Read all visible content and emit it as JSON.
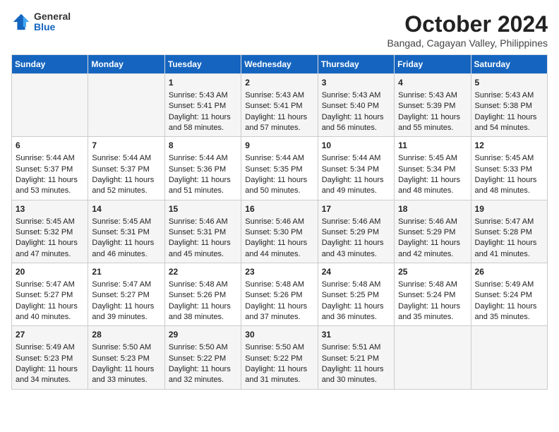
{
  "header": {
    "logo_line1": "General",
    "logo_line2": "Blue",
    "month_title": "October 2024",
    "location": "Bangad, Cagayan Valley, Philippines"
  },
  "days_of_week": [
    "Sunday",
    "Monday",
    "Tuesday",
    "Wednesday",
    "Thursday",
    "Friday",
    "Saturday"
  ],
  "weeks": [
    [
      {
        "day": "",
        "content": ""
      },
      {
        "day": "",
        "content": ""
      },
      {
        "day": "1",
        "content": "Sunrise: 5:43 AM\nSunset: 5:41 PM\nDaylight: 11 hours and 58 minutes."
      },
      {
        "day": "2",
        "content": "Sunrise: 5:43 AM\nSunset: 5:41 PM\nDaylight: 11 hours and 57 minutes."
      },
      {
        "day": "3",
        "content": "Sunrise: 5:43 AM\nSunset: 5:40 PM\nDaylight: 11 hours and 56 minutes."
      },
      {
        "day": "4",
        "content": "Sunrise: 5:43 AM\nSunset: 5:39 PM\nDaylight: 11 hours and 55 minutes."
      },
      {
        "day": "5",
        "content": "Sunrise: 5:43 AM\nSunset: 5:38 PM\nDaylight: 11 hours and 54 minutes."
      }
    ],
    [
      {
        "day": "6",
        "content": "Sunrise: 5:44 AM\nSunset: 5:37 PM\nDaylight: 11 hours and 53 minutes."
      },
      {
        "day": "7",
        "content": "Sunrise: 5:44 AM\nSunset: 5:37 PM\nDaylight: 11 hours and 52 minutes."
      },
      {
        "day": "8",
        "content": "Sunrise: 5:44 AM\nSunset: 5:36 PM\nDaylight: 11 hours and 51 minutes."
      },
      {
        "day": "9",
        "content": "Sunrise: 5:44 AM\nSunset: 5:35 PM\nDaylight: 11 hours and 50 minutes."
      },
      {
        "day": "10",
        "content": "Sunrise: 5:44 AM\nSunset: 5:34 PM\nDaylight: 11 hours and 49 minutes."
      },
      {
        "day": "11",
        "content": "Sunrise: 5:45 AM\nSunset: 5:34 PM\nDaylight: 11 hours and 48 minutes."
      },
      {
        "day": "12",
        "content": "Sunrise: 5:45 AM\nSunset: 5:33 PM\nDaylight: 11 hours and 48 minutes."
      }
    ],
    [
      {
        "day": "13",
        "content": "Sunrise: 5:45 AM\nSunset: 5:32 PM\nDaylight: 11 hours and 47 minutes."
      },
      {
        "day": "14",
        "content": "Sunrise: 5:45 AM\nSunset: 5:31 PM\nDaylight: 11 hours and 46 minutes."
      },
      {
        "day": "15",
        "content": "Sunrise: 5:46 AM\nSunset: 5:31 PM\nDaylight: 11 hours and 45 minutes."
      },
      {
        "day": "16",
        "content": "Sunrise: 5:46 AM\nSunset: 5:30 PM\nDaylight: 11 hours and 44 minutes."
      },
      {
        "day": "17",
        "content": "Sunrise: 5:46 AM\nSunset: 5:29 PM\nDaylight: 11 hours and 43 minutes."
      },
      {
        "day": "18",
        "content": "Sunrise: 5:46 AM\nSunset: 5:29 PM\nDaylight: 11 hours and 42 minutes."
      },
      {
        "day": "19",
        "content": "Sunrise: 5:47 AM\nSunset: 5:28 PM\nDaylight: 11 hours and 41 minutes."
      }
    ],
    [
      {
        "day": "20",
        "content": "Sunrise: 5:47 AM\nSunset: 5:27 PM\nDaylight: 11 hours and 40 minutes."
      },
      {
        "day": "21",
        "content": "Sunrise: 5:47 AM\nSunset: 5:27 PM\nDaylight: 11 hours and 39 minutes."
      },
      {
        "day": "22",
        "content": "Sunrise: 5:48 AM\nSunset: 5:26 PM\nDaylight: 11 hours and 38 minutes."
      },
      {
        "day": "23",
        "content": "Sunrise: 5:48 AM\nSunset: 5:26 PM\nDaylight: 11 hours and 37 minutes."
      },
      {
        "day": "24",
        "content": "Sunrise: 5:48 AM\nSunset: 5:25 PM\nDaylight: 11 hours and 36 minutes."
      },
      {
        "day": "25",
        "content": "Sunrise: 5:48 AM\nSunset: 5:24 PM\nDaylight: 11 hours and 35 minutes."
      },
      {
        "day": "26",
        "content": "Sunrise: 5:49 AM\nSunset: 5:24 PM\nDaylight: 11 hours and 35 minutes."
      }
    ],
    [
      {
        "day": "27",
        "content": "Sunrise: 5:49 AM\nSunset: 5:23 PM\nDaylight: 11 hours and 34 minutes."
      },
      {
        "day": "28",
        "content": "Sunrise: 5:50 AM\nSunset: 5:23 PM\nDaylight: 11 hours and 33 minutes."
      },
      {
        "day": "29",
        "content": "Sunrise: 5:50 AM\nSunset: 5:22 PM\nDaylight: 11 hours and 32 minutes."
      },
      {
        "day": "30",
        "content": "Sunrise: 5:50 AM\nSunset: 5:22 PM\nDaylight: 11 hours and 31 minutes."
      },
      {
        "day": "31",
        "content": "Sunrise: 5:51 AM\nSunset: 5:21 PM\nDaylight: 11 hours and 30 minutes."
      },
      {
        "day": "",
        "content": ""
      },
      {
        "day": "",
        "content": ""
      }
    ]
  ]
}
